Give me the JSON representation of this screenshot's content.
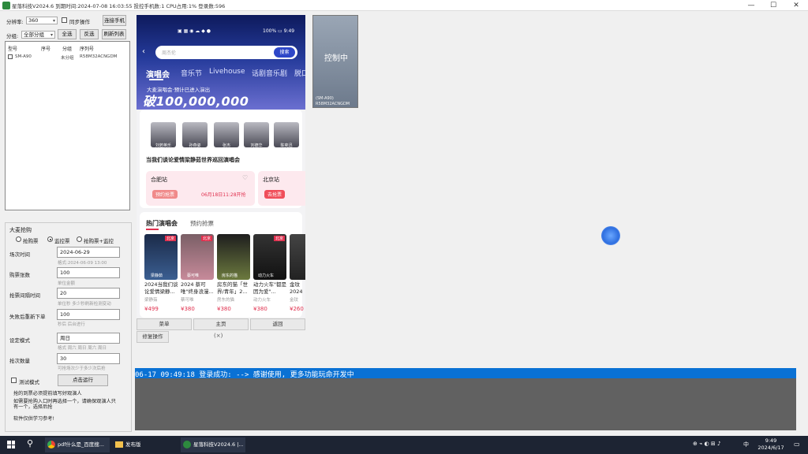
{
  "window": {
    "title": "星落科技V2024.6   到期时间:2024-07-08 16:03:55 投控手机数:1   CPU占用:1% 登录数:596",
    "minimize": "—",
    "maximize": "☐",
    "close": "✕"
  },
  "left": {
    "resolution_label": "分辨率:",
    "resolution_value": "360",
    "sync_label": "同步操作",
    "connect_button": "连接手机",
    "group_label": "分组:",
    "group_value": "全部分组",
    "select_all": "全选",
    "invert": "反选",
    "refresh": "刷新列表",
    "list_headers": [
      "型号",
      "序号",
      "分组",
      "序列号"
    ],
    "device_rows": [
      [
        "SM-A90",
        "",
        "未分组",
        "R58M32ACNGDM"
      ]
    ],
    "options_title": "大麦抢购",
    "radio_options": [
      "抢购票",
      "监控票",
      "抢购票+监控"
    ],
    "fields": [
      {
        "label": "场次时间",
        "value": "2024-06-29",
        "hint": "格式:2024-06-09 13:00"
      },
      {
        "label": "购票张数",
        "value": "100",
        "hint": "单位金额"
      },
      {
        "label": "抢票间隔时间",
        "value": "20",
        "hint": "单位秒 多少秒刷新检测变动"
      },
      {
        "label": "失败后重新下单",
        "value": "100",
        "hint": "秒后 后台进行"
      },
      {
        "label": "设定模式",
        "value": "周日",
        "hint": "格式 周六 周日 周六 周日"
      },
      {
        "label": "抢次数量",
        "value": "30",
        "hint": "可抢场次少于多少次后抢"
      }
    ],
    "test_mode": "测试模式",
    "start_button": "点击运行",
    "note1": "抢的到票必须提前填写好观演人",
    "note2": "如需要抢购入口时再选择一个，请确保观演人只有一个，选择后抢",
    "note3": "软件仅供学习参考!"
  },
  "phone": {
    "status_time": "100% ▭ 9:49",
    "search_placeholder": "周杰伦",
    "search_button": "搜索",
    "tabs": [
      "演唱会",
      "音乐节",
      "Livehouse",
      "话剧音乐剧",
      "脱口"
    ],
    "banner_sub": "大麦演唱会·预计已进入演出",
    "banner_big": "破100,000,000",
    "artists": [
      "刘若英乐",
      "孙燕姿",
      "张杰",
      "刘德华",
      "陈奕迅"
    ],
    "concert_title": "当我们谈论爱情梁静茹世界巡回演唱会",
    "city1": "合肥站",
    "city1_btn": "预约抢票",
    "city1_time": "06月18日11:28开抢",
    "city2": "北京站",
    "city2_btn": "去抢票",
    "hot_title": "热门演唱会",
    "reserve_title": "预约抢票",
    "posters": [
      {
        "badge": "北京",
        "artist": "梁静茹",
        "title": "2024当我们谈论爱情梁静...",
        "sub": "梁静茹",
        "price": "¥499"
      },
      {
        "badge": "北京",
        "artist": "蔡可唯",
        "title": "2024 蔡可唯\"终身浪漫...",
        "sub": "蔡可唯",
        "price": "¥380"
      },
      {
        "badge": "",
        "artist": "房东的猫",
        "title": "房东的猫「世界/青年」2...",
        "sub": "房东的猫",
        "price": "¥380"
      },
      {
        "badge": "北京",
        "artist": "动力火车",
        "title": "动力火车\"都是因为爱\"...",
        "sub": "动力火车",
        "price": "¥380"
      },
      {
        "badge": "",
        "artist": "",
        "title": "金玟\n2024",
        "sub": "金玟",
        "price": "¥260"
      }
    ],
    "nav_buttons": [
      "菜单",
      "主页",
      "返回"
    ],
    "fix_button": "修复操作",
    "close_x": "(×)"
  },
  "thumbnail": {
    "label": "控制中",
    "model": "(SM-A90)",
    "serial": "R58M32ACNGDM"
  },
  "log": {
    "line": "06-17 09:49:18 登录成功: --> 感谢使用, 更多功能玩命开发中"
  },
  "taskbar": {
    "apps": [
      "pdf什么是_百度搜...",
      "发布版",
      "星落科技V2024.6 |..."
    ],
    "time": "9:49",
    "date": "2024/6/17",
    "lang": "中"
  }
}
